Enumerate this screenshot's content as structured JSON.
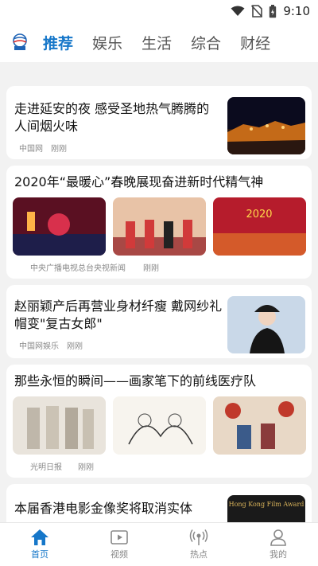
{
  "status_bar": {
    "time": "9:10"
  },
  "app": {
    "logo_text": "CHINA"
  },
  "top_tabs": [
    {
      "label": "推荐",
      "active": true
    },
    {
      "label": "娱乐"
    },
    {
      "label": "生活"
    },
    {
      "label": "综合"
    },
    {
      "label": "财经"
    }
  ],
  "feed": [
    {
      "title": "走进延安的夜 感受圣地热气腾腾的人间烟火味",
      "source": "中国网",
      "time": "刚刚"
    },
    {
      "title": "2020年“最暖心”春晚展现奋进新时代精气神",
      "source": "中央广播电视总台央视新闻",
      "time": "刚刚",
      "thumb_text": "2020"
    },
    {
      "title": "赵丽颖产后再营业身材纤瘦 戴网纱礼帽变\"复古女郎\"",
      "source": "中国网娱乐",
      "time": "刚刚"
    },
    {
      "title": "那些永恒的瞬间——画家笔下的前线医疗队",
      "source": "光明日报",
      "time": "刚刚"
    },
    {
      "title": "本届香港电影金像奖将取消实体",
      "thumb_text": "Hong Kong Film Award"
    }
  ],
  "bottom_nav": [
    {
      "label": "首页",
      "icon": "home-icon",
      "active": true
    },
    {
      "label": "视频",
      "icon": "video-icon"
    },
    {
      "label": "热点",
      "icon": "hotspot-icon"
    },
    {
      "label": "我的",
      "icon": "profile-icon"
    }
  ],
  "colors": {
    "accent": "#1677c9",
    "inactive": "#888888"
  }
}
